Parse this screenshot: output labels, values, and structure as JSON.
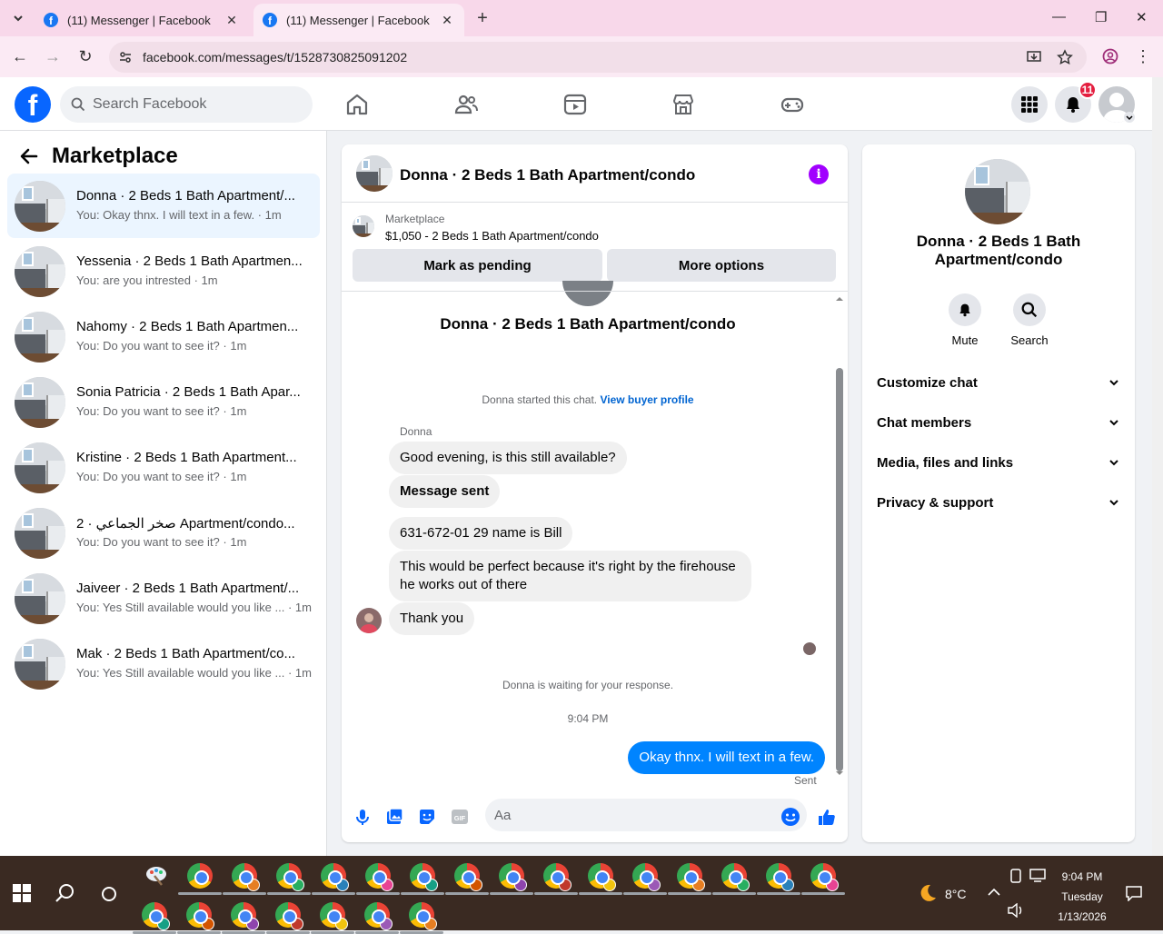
{
  "browser": {
    "tabs": [
      {
        "title": "(11) Messenger | Facebook",
        "active": false
      },
      {
        "title": "(11) Messenger | Facebook",
        "active": true
      }
    ],
    "url": "facebook.com/messages/t/1528730825091202"
  },
  "fb_header": {
    "logo": "f",
    "search_placeholder": "Search Facebook",
    "notification_count": "11"
  },
  "left_panel": {
    "title": "Marketplace",
    "conversations": [
      {
        "name": "Donna · 2 Beds 1 Bath Apartment/...",
        "preview": "You: Okay thnx. I will text in a few. · 1m",
        "active": true
      },
      {
        "name": "Yessenia · 2 Beds 1 Bath Apartmen...",
        "preview": "You: are you intrested · 1m"
      },
      {
        "name": "Nahomy · 2 Beds 1 Bath Apartmen...",
        "preview": "You: Do you want to see it? · 1m"
      },
      {
        "name": "Sonia Patricia · 2 Beds 1 Bath Apar...",
        "preview": "You: Do you want to see it? · 1m"
      },
      {
        "name": "Kristine · 2 Beds 1 Bath Apartment...",
        "preview": "You: Do you want to see it? · 1m"
      },
      {
        "name": "صخر الجماعي · 2 Apartment/condo...",
        "preview": "You: Do you want to see it? · 1m"
      },
      {
        "name": "Jaiveer · 2 Beds 1 Bath Apartment/...",
        "preview": "You: Yes Still available would you like ... · 1m"
      },
      {
        "name": "Mak · 2 Beds 1 Bath Apartment/co...",
        "preview": "You: Yes Still available would you like ... · 1m"
      }
    ]
  },
  "chat": {
    "header_title": "Donna · 2 Beds 1 Bath Apartment/condo",
    "info_icon": "i",
    "marketplace_label": "Marketplace",
    "listing_price": "$1,050 - 2 Beds 1 Bath Apartment/condo",
    "mark_pending_label": "Mark as pending",
    "more_options_label": "More options",
    "chat_title": "Donna · 2 Beds 1 Bath Apartment/condo",
    "started_text": "Donna started this chat. ",
    "view_buyer_profile": "View buyer profile",
    "sender_name": "Donna",
    "messages": [
      "Good evening, is this still available?",
      "Message sent",
      "631-672-01 29 name is Bill",
      "This would be perfect because it's right by the firehouse he works out of there",
      "Thank you"
    ],
    "waiting_text": "Donna is waiting for your response.",
    "time_divider": "9:04 PM",
    "my_message": "Okay thnx. I will text in a few.",
    "sent_label": "Sent",
    "composer_placeholder": "Aa"
  },
  "right_panel": {
    "name": "Donna · 2 Beds 1 Bath Apartment/condo",
    "mute_label": "Mute",
    "search_label": "Search",
    "sections": [
      "Customize chat",
      "Chat members",
      "Media, files and links",
      "Privacy & support"
    ]
  },
  "taskbar": {
    "weather": "8°C",
    "time": "9:04 PM",
    "day": "Tuesday",
    "date": "1/13/2026",
    "profile_colors": [
      "#9b59b6",
      "#e67e22",
      "#27ae60",
      "#2980b9",
      "#e84393",
      "#16a085",
      "#d35400",
      "#8e44ad",
      "#c0392b",
      "#f1c40f"
    ]
  }
}
